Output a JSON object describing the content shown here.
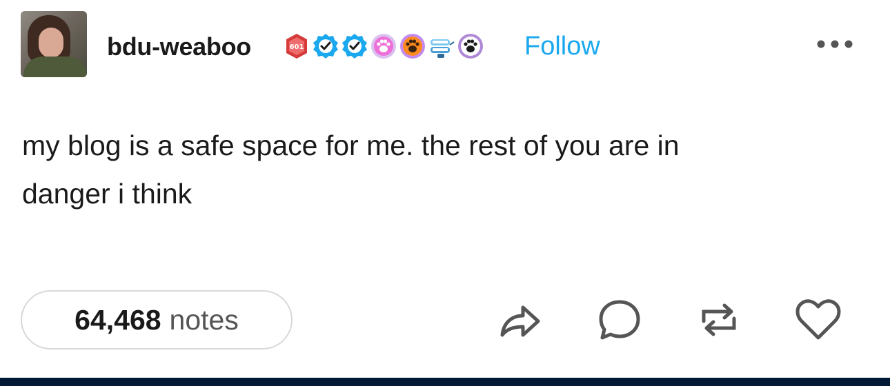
{
  "post": {
    "username": "bdu-weaboo",
    "follow_label": "Follow",
    "text_line1": "my blog is a safe space for me. the rest of you are in",
    "text_line2": "danger i think",
    "notes_count": "64,468",
    "notes_label": "notes"
  },
  "badges": [
    {
      "name": "top-badge-icon",
      "label": "601",
      "color": "#d63b3b"
    },
    {
      "name": "verified-checkmark-icon",
      "color": "#1aa8ee"
    },
    {
      "name": "verified-checkmark-icon",
      "color": "#1aa8ee"
    },
    {
      "name": "pink-paw-icon",
      "color": "#ee6fd8"
    },
    {
      "name": "orange-paw-icon",
      "color": "#ff8a1f"
    },
    {
      "name": "chattering-teeth-icon",
      "color": "#7ec8f0"
    },
    {
      "name": "black-paw-icon",
      "color": "#1a1a1a"
    }
  ],
  "colors": {
    "accent": "#1aa8ee",
    "text": "#1a1a1a",
    "muted": "#555555",
    "border": "#d8d8d8",
    "bottom_bar": "#001935"
  },
  "actions": [
    "share-icon",
    "reply-icon",
    "reblog-icon",
    "like-icon"
  ]
}
